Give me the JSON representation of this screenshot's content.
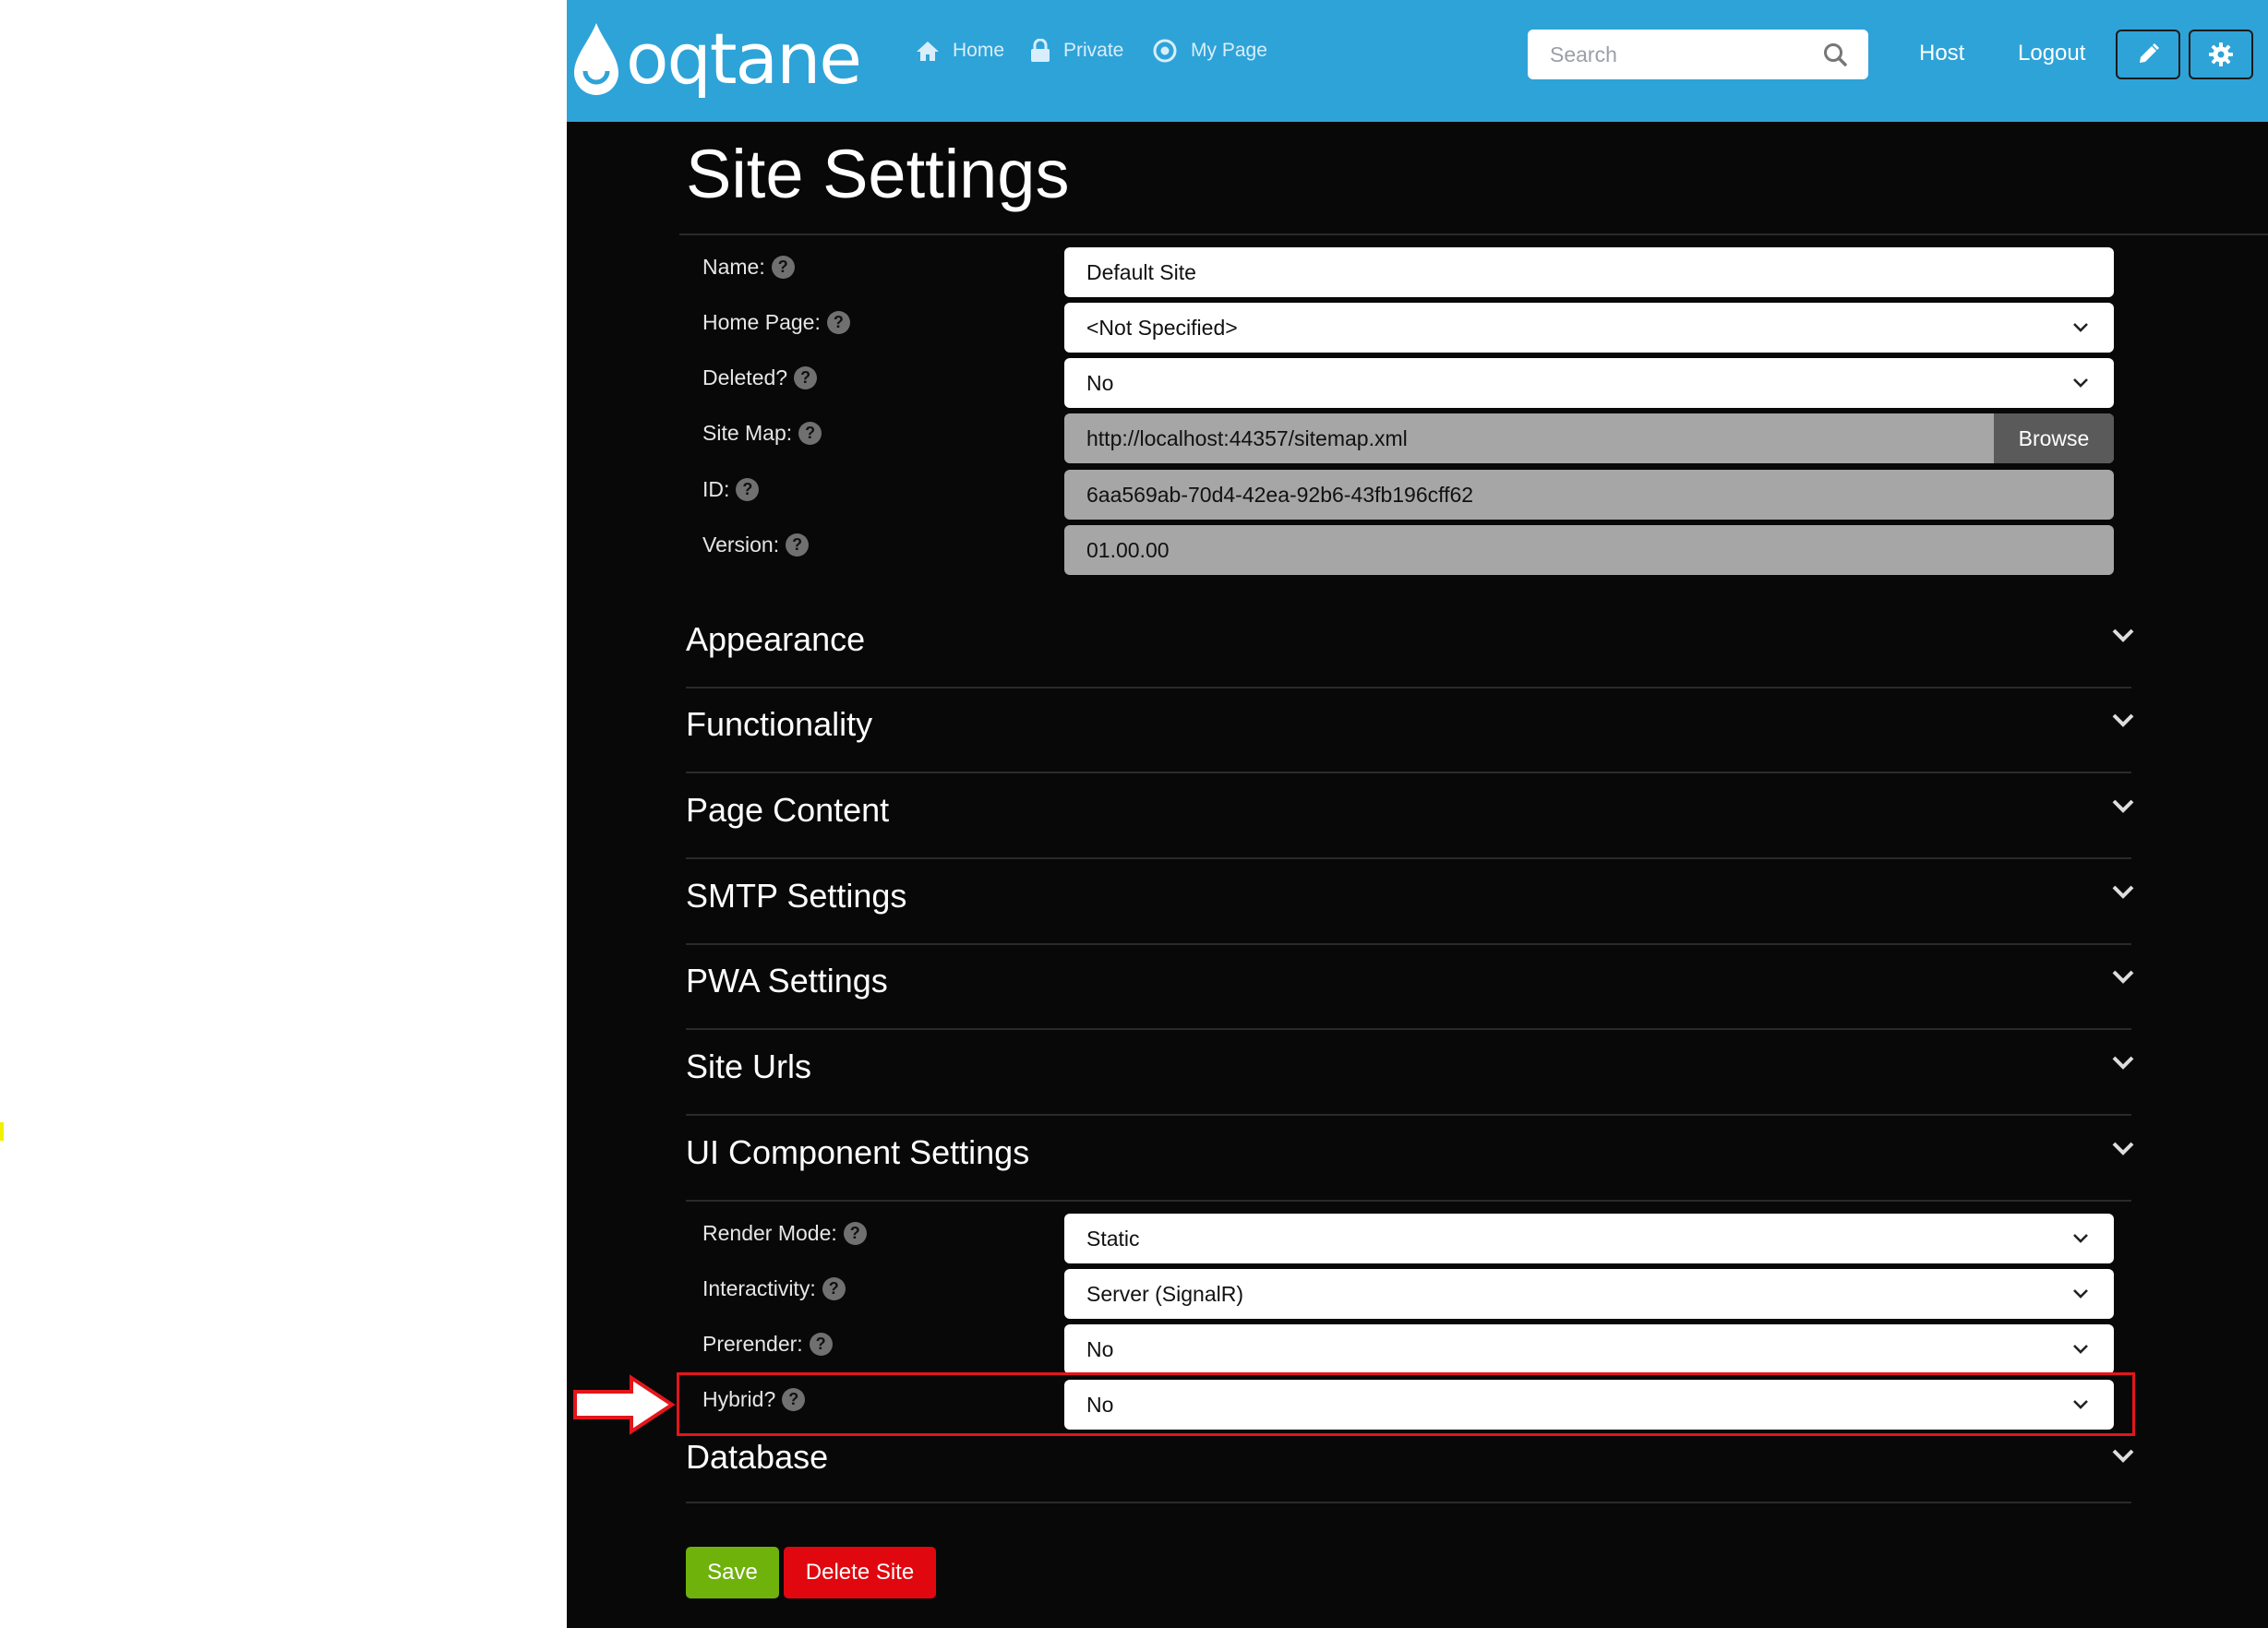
{
  "brand": {
    "logo_text": "oqtane"
  },
  "nav": {
    "items": [
      {
        "label": "Home",
        "icon": "home-icon"
      },
      {
        "label": "Private",
        "icon": "lock-icon"
      },
      {
        "label": "My Page",
        "icon": "target-icon"
      }
    ],
    "search_placeholder": "Search",
    "host_label": "Host",
    "logout_label": "Logout"
  },
  "page": {
    "title": "Site Settings"
  },
  "fields": {
    "name": {
      "label": "Name:",
      "value": "Default Site"
    },
    "home_page": {
      "label": "Home Page:",
      "value": "<Not Specified>"
    },
    "deleted": {
      "label": "Deleted?",
      "value": "No"
    },
    "site_map": {
      "label": "Site Map:",
      "value": "http://localhost:44357/sitemap.xml",
      "button": "Browse"
    },
    "id": {
      "label": "ID:",
      "value": "6aa569ab-70d4-42ea-92b6-43fb196cff62"
    },
    "version": {
      "label": "Version:",
      "value": "01.00.00"
    }
  },
  "sections": {
    "appearance": "Appearance",
    "functionality": "Functionality",
    "page_content": "Page Content",
    "smtp": "SMTP Settings",
    "pwa": "PWA Settings",
    "site_urls": "Site Urls",
    "ui_component": "UI Component Settings",
    "database": "Database"
  },
  "ui_component_fields": {
    "render_mode": {
      "label": "Render Mode:",
      "value": "Static"
    },
    "interactivity": {
      "label": "Interactivity:",
      "value": "Server (SignalR)"
    },
    "prerender": {
      "label": "Prerender:",
      "value": "No"
    },
    "hybrid": {
      "label": "Hybrid?",
      "value": "No"
    }
  },
  "help_glyph": "?",
  "actions": {
    "save": "Save",
    "delete": "Delete Site"
  },
  "colors": {
    "navbar": "#2ea3d8",
    "save": "#6fb20b",
    "delete": "#e0070f",
    "highlight": "#e3161b"
  }
}
